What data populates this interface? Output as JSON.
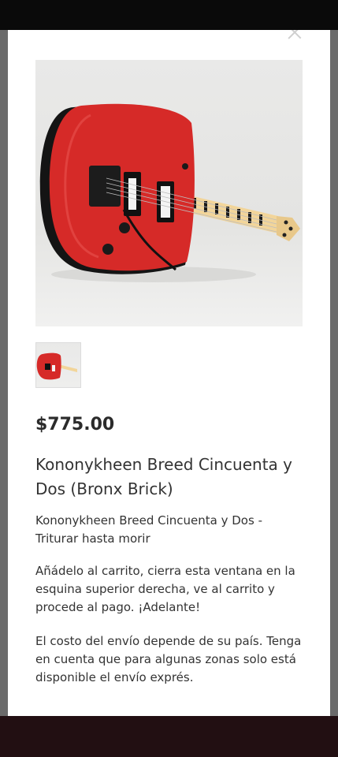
{
  "product": {
    "price": "$775.00",
    "title": "Kononykheen Breed Cincuenta y Dos (Bronx Brick)",
    "subtitle": "Kononykheen Breed Cincuenta y Dos - Triturar hasta morir",
    "cart_instructions": "Añádelo al carrito, cierra esta ventana en la esquina superior derecha, ve al carrito y procede al pago. ¡Adelante!",
    "shipping_note": "El costo del envío depende de su país. Tenga en cuenta que para algunas zonas solo está disponible el envío exprés."
  },
  "colors": {
    "guitar_body": "#d62a28",
    "overlay": "#6b6b6b",
    "text": "#333333"
  },
  "icons": [
    "close-icon"
  ]
}
